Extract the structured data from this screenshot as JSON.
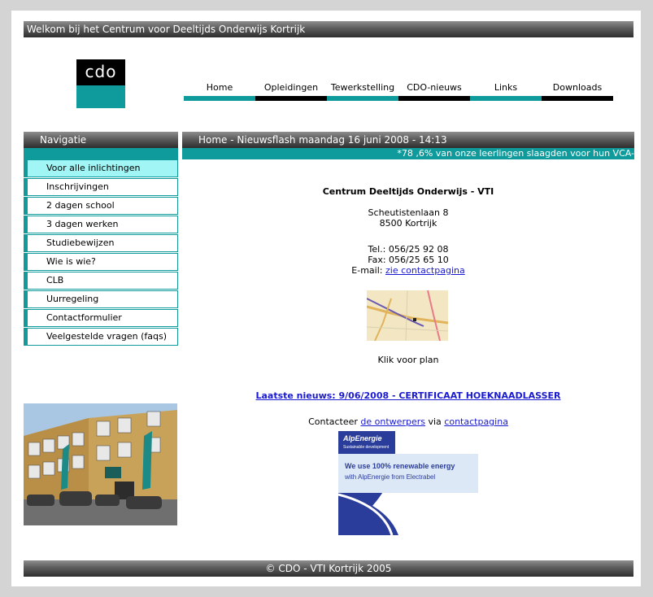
{
  "header": {
    "welcome": "Welkom bij het Centrum voor Deeltijds Onderwijs Kortrijk"
  },
  "logo": {
    "text": "cdo"
  },
  "nav": {
    "items": [
      "Home",
      "Opleidingen",
      "Tewerkstelling",
      "CDO-nieuws",
      "Links",
      "Downloads"
    ]
  },
  "sidebar": {
    "title": "Navigatie",
    "items": [
      "Voor alle inlichtingen",
      "Inschrijvingen",
      "2 dagen school",
      "3 dagen werken",
      "Studiebewijzen",
      "Wie is wie?",
      "CLB",
      "Uurregeling",
      "Contactformulier",
      "Veelgestelde vragen (faqs)"
    ]
  },
  "main": {
    "title": "Home - Nieuwsflash maandag 16 juni 2008 - 14:13",
    "ticker": "*78 ,6% van onze leerlingen slaagden voor hun VCA-",
    "org_name": "Centrum Deeltijds Onderwijs - VTI",
    "street": "Scheutistenlaan 8",
    "city": "8500 Kortrijk",
    "tel": "Tel.: 056/25 92 08",
    "fax": "Fax: 056/25 65 10",
    "email_label": "E-mail:",
    "email_link": "zie contactpagina",
    "map_caption": "Klik voor plan",
    "news_link": "Laatste nieuws: 9/06/2008 - CERTIFICAAT HOEKNAADLASSER",
    "contact_prefix": "Contacteer",
    "designers_link": "de ontwerpers",
    "contact_mid": "via",
    "contact_link": "contactpagina"
  },
  "banner": {
    "brand": "AlpEnergie",
    "tagline": "Sustainable development",
    "line1": "We use 100% renewable energy",
    "line2": "with AlpEnergie from Electrabel"
  },
  "footer": {
    "text": "© CDO - VTI Kortrijk 2005"
  },
  "colors": {
    "teal": "#0f9b9b",
    "active_item": "#a2f5f5",
    "link": "#1a1ad0"
  }
}
